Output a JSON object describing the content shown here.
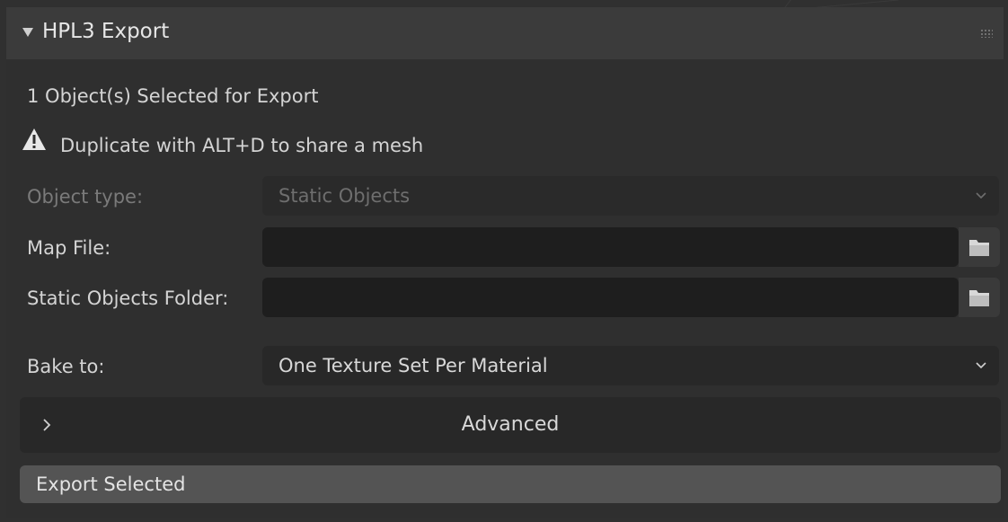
{
  "panel": {
    "title": "HPL3 Export",
    "selected_count_text": "1 Object(s) Selected for Export",
    "warning_text": "Duplicate with ALT+D to share a mesh"
  },
  "fields": {
    "object_type": {
      "label": "Object type:",
      "value": "Static Objects"
    },
    "map_file": {
      "label": "Map File:",
      "value": ""
    },
    "static_objects_folder": {
      "label": "Static Objects Folder:",
      "value": ""
    },
    "bake_to": {
      "label": "Bake to:",
      "value": "One Texture Set Per Material"
    }
  },
  "advanced": {
    "label": "Advanced"
  },
  "export": {
    "label": "Export Selected"
  },
  "icons": {
    "collapse": "triangle-down-icon",
    "warning": "warning-icon",
    "folder": "folder-icon",
    "dropdown": "chevron-down-icon",
    "expand": "chevron-right-icon",
    "grip": "grip-icon"
  },
  "colors": {
    "panel_bg": "#2f2f2f",
    "header_bg": "#3b3b3b",
    "field_bg": "#1e1e1e",
    "button_bg": "#545454"
  }
}
